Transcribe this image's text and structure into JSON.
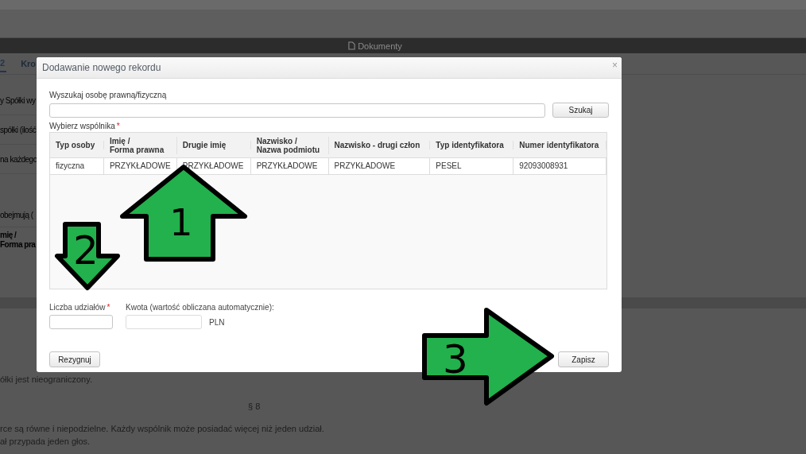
{
  "page": {
    "header_title": "Dokumenty",
    "tabs": [
      {
        "label": "2",
        "selected": true
      },
      {
        "label": "Kro",
        "selected": false
      }
    ],
    "form_fragments": [
      "y Spółki wy",
      "spółki (ilość",
      "na każdego"
    ],
    "note_fragment": "obejmują (",
    "table_header_fragment": [
      "mię /",
      "Forma pra"
    ],
    "text_lines": [
      {
        "kind": "text",
        "text": "ółki jest nieograniczony."
      },
      {
        "kind": "section",
        "text": "§ 8"
      },
      {
        "kind": "text",
        "text": "rce są równe i niepodzielne. Każdy wspólnik może posiadać więcej niż jeden udział."
      },
      {
        "kind": "text",
        "text": "ał przypada jeden głos."
      }
    ]
  },
  "dialog": {
    "title": "Dodawanie nowego rekordu",
    "close": "×",
    "required_mark": "*",
    "search": {
      "label": "Wyszukaj osobę prawną/fizyczną",
      "button": "Szukaj"
    },
    "table": {
      "label": "Wybierz wspólnika",
      "required": true,
      "columns": [
        "Typ osoby",
        "Imię /\nForma prawna",
        "Drugie imię",
        "Nazwisko /\nNazwa podmiotu",
        "Nazwisko - drugi człon",
        "Typ identyfikatora",
        "Numer identyfikatora"
      ],
      "rows": [
        {
          "selected": false,
          "cells": [
            "fizyczna",
            "PRZYKŁADOWE",
            "PRZYKŁADOWE",
            "PRZYKŁADOWE",
            "PRZYKŁADOWE",
            "PESEL",
            "92093008931"
          ]
        }
      ]
    },
    "shares": {
      "label": "Liczba udziałów",
      "required": true
    },
    "amount": {
      "label": "Kwota (wartość obliczana automatycznie):",
      "unit": "PLN"
    },
    "buttons": [
      "Rezygnuj",
      "Zapisz"
    ]
  },
  "annotations": [
    {
      "kind": "up",
      "label": "1"
    },
    {
      "kind": "down",
      "label": "2"
    },
    {
      "kind": "right",
      "label": "3"
    }
  ]
}
